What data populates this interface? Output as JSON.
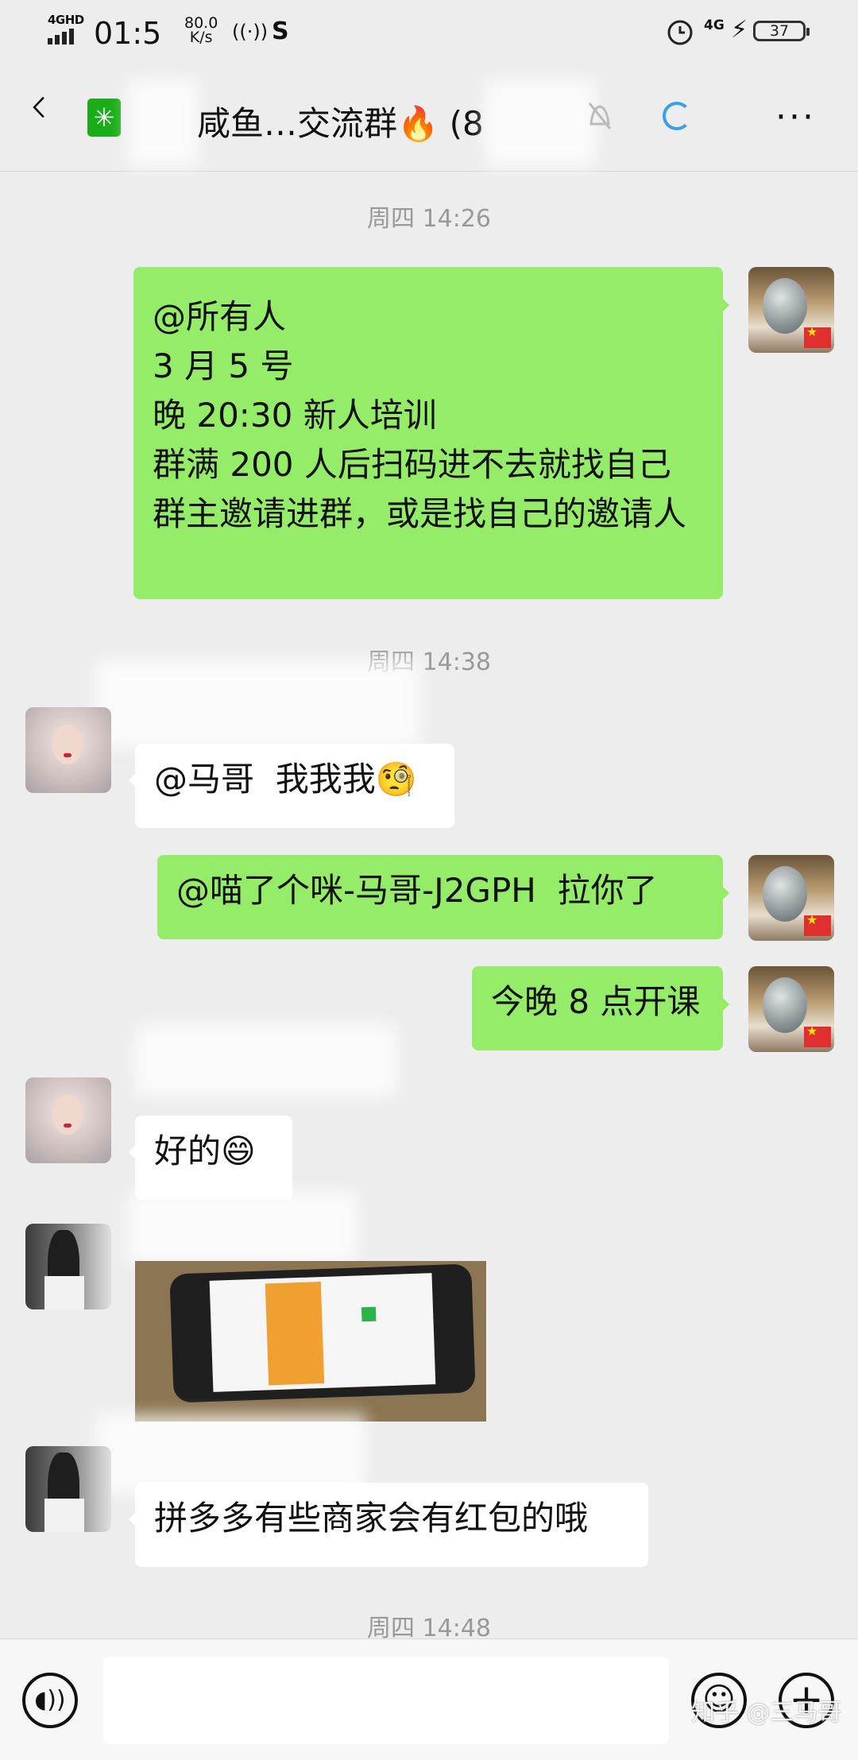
{
  "status_bar": {
    "network": "4GHD",
    "time": "01:5",
    "speed": "80.0",
    "speed_unit": "K/s",
    "network_right": "4G",
    "battery": "37"
  },
  "header": {
    "title": "咸鱼…交流群🔥 (8"
  },
  "messages": {
    "ts1": "周四 14:26",
    "m1": "@所有人\n3 月 5 号\n晚 20:30 新人培训\n群满 200 人后扫码进不去就找自己群主邀请进群，或是找自己的邀请人",
    "ts2": "周四 14:38",
    "m2": "@马哥  我我我🧐",
    "m3": "@喵了个咪-马哥-J2GPH  拉你了",
    "m4": "今晚 8 点开课",
    "m5": "好的😄",
    "m7": "拼多多有些商家会有红包的哦",
    "ts3": "周四 14:48"
  },
  "watermark": "知乎 @三马哥",
  "colors": {
    "green_bubble": "#95ec69",
    "white_bubble": "#ffffff",
    "background": "#ededed"
  }
}
